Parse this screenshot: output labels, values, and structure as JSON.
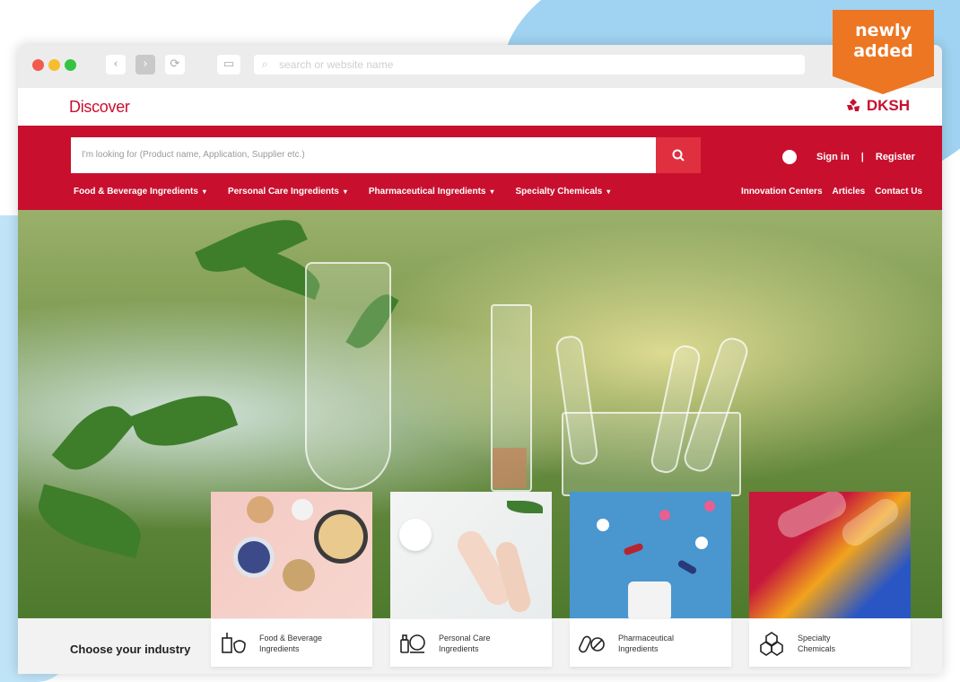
{
  "badge": {
    "line1": "newly",
    "line2": "added",
    "color": "#ed7623"
  },
  "browser": {
    "address_placeholder": "search or website name",
    "back_icon": "chevron-left-icon",
    "forward_icon": "chevron-right-icon",
    "reload_icon": "reload-icon",
    "sidebar_icon": "sidebar-icon"
  },
  "site": {
    "logo": "Discover",
    "brand": "DKSH",
    "brand_color": "#c8102e",
    "search_placeholder": "I'm looking for (Product name, Application, Supplier etc.)",
    "sign_in": "Sign in",
    "separator": "|",
    "register": "Register",
    "menu": [
      {
        "label": "Food & Beverage Ingredients"
      },
      {
        "label": "Personal Care Ingredients"
      },
      {
        "label": "Pharmaceutical Ingredients"
      },
      {
        "label": "Specialty Chemicals"
      }
    ],
    "menu_right": [
      "Innovation Centers",
      "Articles",
      "Contact Us"
    ]
  },
  "industry": {
    "heading": "Choose your industry",
    "cards": [
      {
        "line1": "Food & Beverage",
        "line2": "Ingredients",
        "icon": "food-beverage-icon"
      },
      {
        "line1": "Personal Care",
        "line2": "Ingredients",
        "icon": "personal-care-icon"
      },
      {
        "line1": "Pharmaceutical",
        "line2": "Ingredients",
        "icon": "pills-icon"
      },
      {
        "line1": "Specialty",
        "line2": "Chemicals",
        "icon": "chemicals-icon"
      }
    ]
  }
}
